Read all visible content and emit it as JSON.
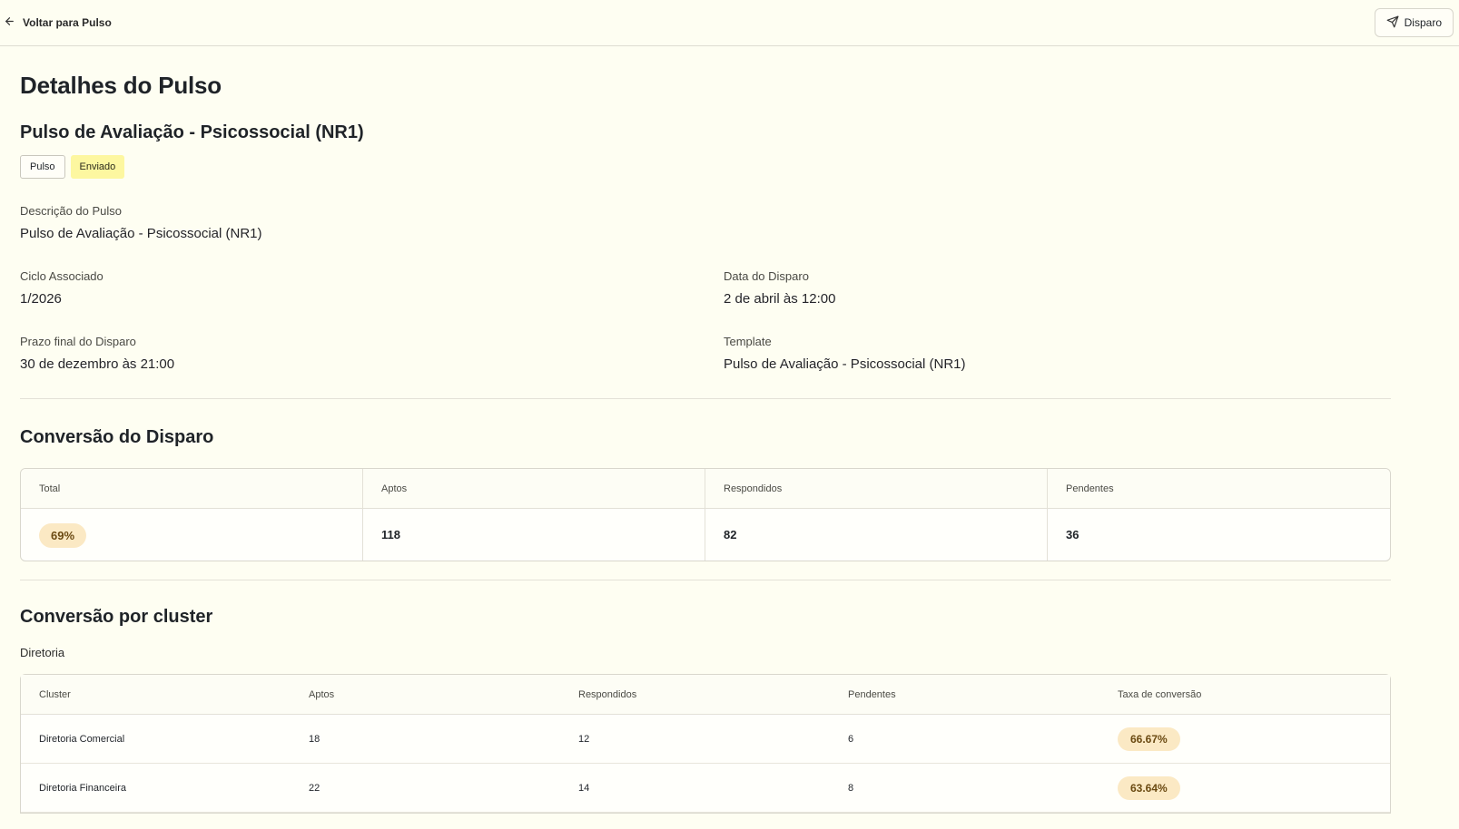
{
  "topbar": {
    "back_label": "Voltar para Pulso",
    "disparo_label": "Disparo"
  },
  "page": {
    "title": "Detalhes do Pulso",
    "pulse_name": "Pulso de Avaliação - Psicossocial (NR1)",
    "badges": [
      "Pulso",
      "Enviado"
    ]
  },
  "details": {
    "description_label": "Descrição do Pulso",
    "description_value": "Pulso de Avaliação - Psicossocial (NR1)",
    "cycle_label": "Ciclo Associado",
    "cycle_value": "1/2026",
    "send_date_label": "Data do Disparo",
    "send_date_value": "2 de abril às 12:00",
    "deadline_label": "Prazo final do Disparo",
    "deadline_value": "30 de dezembro às 21:00",
    "template_label": "Template",
    "template_value": "Pulso de Avaliação - Psicossocial (NR1)"
  },
  "conversion": {
    "title": "Conversão do Disparo",
    "headers": [
      "Total",
      "Aptos",
      "Respondidos",
      "Pendentes"
    ],
    "total": "69%",
    "aptos": "118",
    "respondidos": "82",
    "pendentes": "36"
  },
  "cluster": {
    "title": "Conversão por cluster",
    "group": "Diretoria",
    "headers": [
      "Cluster",
      "Aptos",
      "Respondidos",
      "Pendentes",
      "Taxa de conversão"
    ],
    "rows": [
      {
        "name": "Diretoria Comercial",
        "aptos": "18",
        "respondidos": "12",
        "pendentes": "6",
        "taxa": "66.67%"
      },
      {
        "name": "Diretoria Financeira",
        "aptos": "22",
        "respondidos": "14",
        "pendentes": "8",
        "taxa": "63.64%"
      }
    ]
  },
  "colors": {
    "background": "#fefef2",
    "badge_yellow": "#fdf7a0",
    "pill": "#fbe9c4"
  },
  "icons": [
    "arrow-left-icon",
    "send-icon"
  ]
}
